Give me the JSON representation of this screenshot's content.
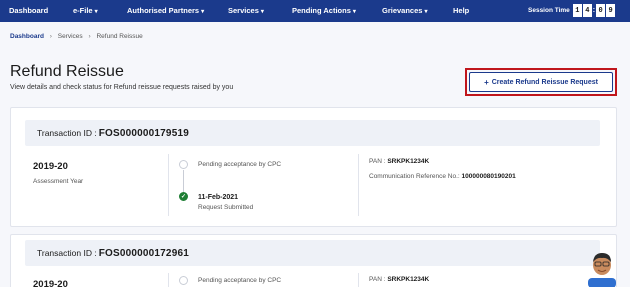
{
  "nav": {
    "items": [
      {
        "label": "Dashboard",
        "caret": ""
      },
      {
        "label": "e-File",
        "caret": "▾"
      },
      {
        "label": "Authorised Partners",
        "caret": "▾"
      },
      {
        "label": "Services",
        "caret": "▾"
      },
      {
        "label": "Pending Actions",
        "caret": "▾"
      },
      {
        "label": "Grievances",
        "caret": "▾"
      },
      {
        "label": "Help",
        "caret": ""
      }
    ],
    "session_label": "Session Time",
    "session_digits": [
      "1",
      "4",
      "0",
      "9"
    ],
    "session_colon": ":"
  },
  "breadcrumb": {
    "items": [
      "Dashboard",
      "Services",
      "Refund Reissue"
    ],
    "separator": "›"
  },
  "page": {
    "title": "Refund Reissue",
    "subtitle": "View details and check status for Refund reissue requests raised by you",
    "create_button": "Create Refund Reissue Request",
    "create_icon": "+"
  },
  "transactions": [
    {
      "label": "Transaction ID :",
      "id": "FOS000000179519",
      "year": "2019-20",
      "year_label": "Assessment Year",
      "status_pending": "Pending acceptance by CPC",
      "status_done_date": "11-Feb-2021",
      "status_done_label": "Request Submitted",
      "pan_label": "PAN :",
      "pan": "SRKPK1234K",
      "comm_label": "Communication Reference No.:",
      "comm_ref": "100000080190201"
    },
    {
      "label": "Transaction ID :",
      "id": "FOS000000172961",
      "year": "2019-20",
      "status_pending": "Pending acceptance by CPC",
      "pan_label": "PAN :",
      "pan": "SRKPK1234K"
    }
  ],
  "colors": {
    "nav_bg": "#1b3a8c",
    "highlight": "#c0161c",
    "success": "#1e7e34"
  }
}
